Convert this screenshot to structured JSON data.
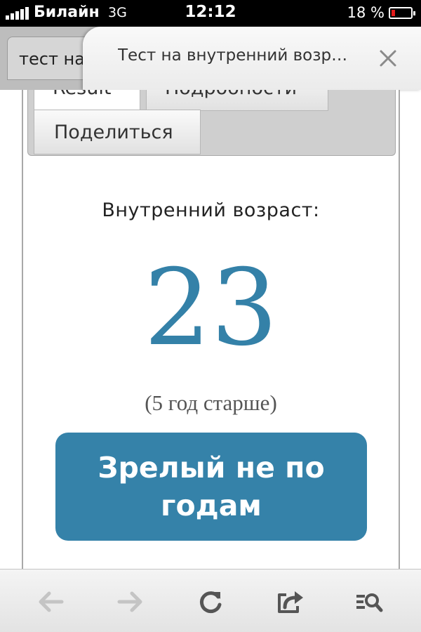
{
  "status": {
    "carrier": "Билайн",
    "network": "3G",
    "time": "12:12",
    "battery_percent": "18 %",
    "battery_level": 0.18,
    "signal_bars": 5
  },
  "tabs": {
    "inactive_title": "тест на",
    "active_title": "Тест на внутренний возр…"
  },
  "result_tabs": {
    "result": "Result",
    "details": "Подробности",
    "share": "Поделиться"
  },
  "result": {
    "label": "Внутренний возраст:",
    "age": "23",
    "difference": "(5 год старше)",
    "verdict": "Зрелый не по годам"
  },
  "colors": {
    "accent": "#3582a9",
    "battery_low": "#e21b1b"
  },
  "icons": {
    "back": "arrow-left-icon",
    "forward": "arrow-right-icon",
    "reload": "reload-icon",
    "share": "share-icon",
    "reader": "reader-search-icon",
    "close": "close-icon"
  }
}
